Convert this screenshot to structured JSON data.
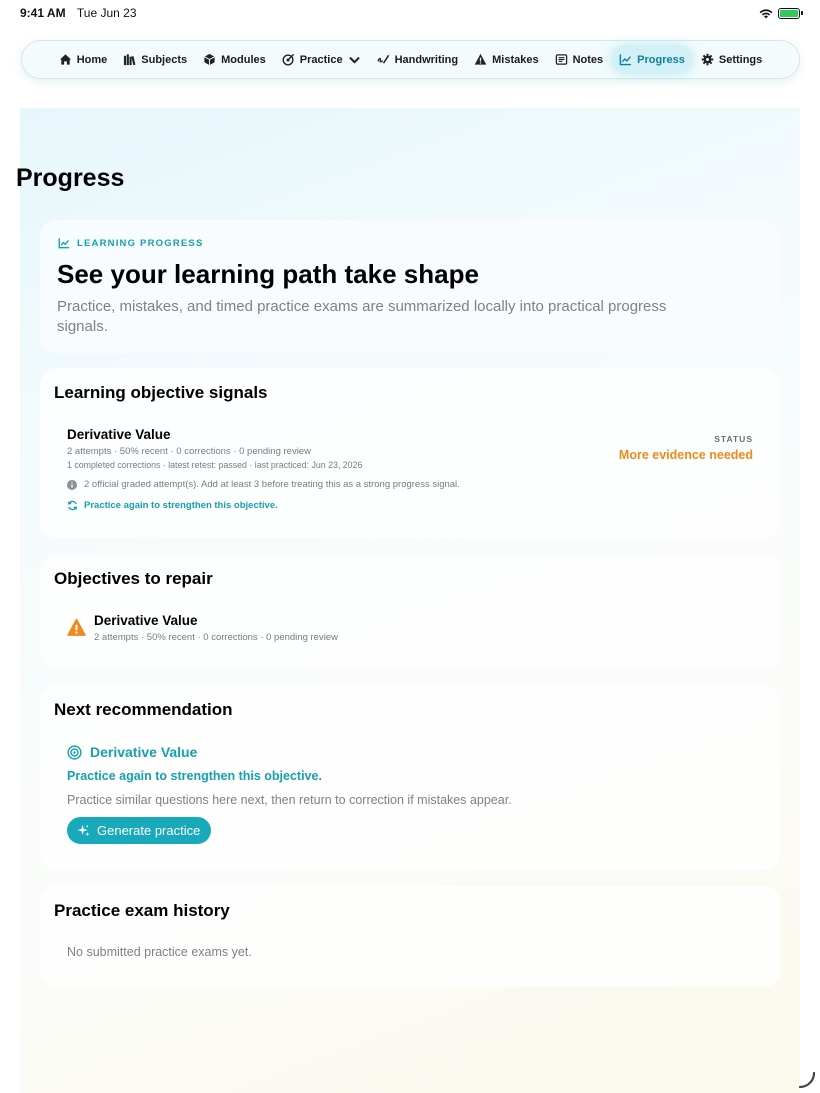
{
  "status_bar": {
    "time": "9:41 AM",
    "date": "Tue Jun 23"
  },
  "nav": {
    "items": [
      {
        "label": "Home",
        "icon": "home-icon"
      },
      {
        "label": "Subjects",
        "icon": "books-icon"
      },
      {
        "label": "Modules",
        "icon": "cube-icon"
      },
      {
        "label": "Practice",
        "icon": "target-pencil-icon",
        "has_menu": true
      },
      {
        "label": "Handwriting",
        "icon": "scribble-icon"
      },
      {
        "label": "Mistakes",
        "icon": "warning-icon"
      },
      {
        "label": "Notes",
        "icon": "notes-icon"
      },
      {
        "label": "Progress",
        "icon": "chart-icon",
        "active": true
      },
      {
        "label": "Settings",
        "icon": "gear-icon"
      }
    ]
  },
  "page": {
    "title": "Progress"
  },
  "hero": {
    "eyebrow": "LEARNING PROGRESS",
    "title": "See your learning path take shape",
    "description": "Practice, mistakes, and timed practice exams are summarized locally into practical progress signals."
  },
  "signals": {
    "title": "Learning objective signals",
    "item": {
      "name": "Derivative Value",
      "meta1": "2 attempts · 50% recent · 0 corrections · 0 pending review",
      "meta2": "1 completed corrections · latest retest: passed · last practiced: Jun 23, 2026",
      "status_label": "STATUS",
      "status": "More evidence needed",
      "note": "2 official graded attempt(s). Add at least 3 before treating this as a strong progress signal.",
      "action": "Practice again to strengthen this objective."
    }
  },
  "repair": {
    "title": "Objectives to repair",
    "item": {
      "name": "Derivative Value",
      "meta": "2 attempts · 50% recent · 0 corrections · 0 pending review"
    }
  },
  "recommendation": {
    "title": "Next recommendation",
    "objective": "Derivative Value",
    "subtitle": "Practice again to strengthen this objective.",
    "description": "Practice similar questions here next, then return to correction if mistakes appear.",
    "button": "Generate practice"
  },
  "history": {
    "title": "Practice exam history",
    "empty": "No submitted practice exams yet."
  },
  "colors": {
    "accent": "#16a0b0",
    "warning": "#ef8a1e",
    "button": "#18aabb"
  }
}
